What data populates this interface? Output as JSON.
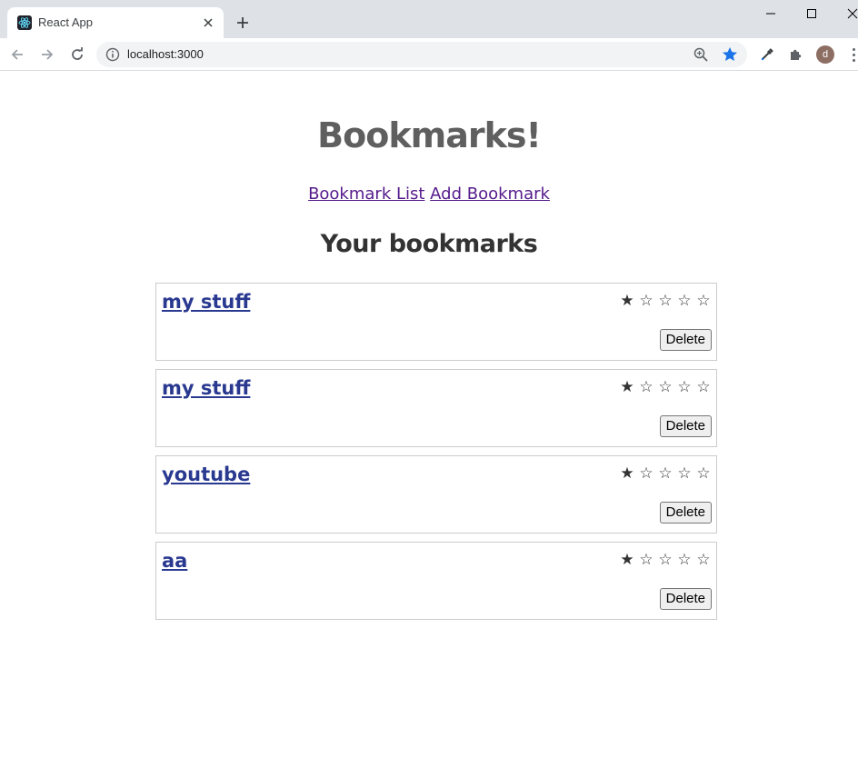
{
  "browser": {
    "tab_title": "React App",
    "url": "localhost:3000",
    "avatar_letter": "d"
  },
  "app": {
    "title": "Bookmarks!",
    "nav": {
      "bookmark_list": "Bookmark List",
      "add_bookmark": "Add Bookmark"
    },
    "section_title": "Your bookmarks",
    "delete_label": "Delete",
    "bookmarks": [
      {
        "title": "my stuff",
        "rating": 1,
        "max_rating": 5
      },
      {
        "title": "my stuff",
        "rating": 1,
        "max_rating": 5
      },
      {
        "title": "youtube",
        "rating": 1,
        "max_rating": 5
      },
      {
        "title": "aa",
        "rating": 1,
        "max_rating": 5
      }
    ]
  },
  "colors": {
    "title": "#5f5f5f",
    "link": "#2a3990",
    "visited_link": "#551a8b",
    "bookmark_star": "#1a73e8"
  }
}
